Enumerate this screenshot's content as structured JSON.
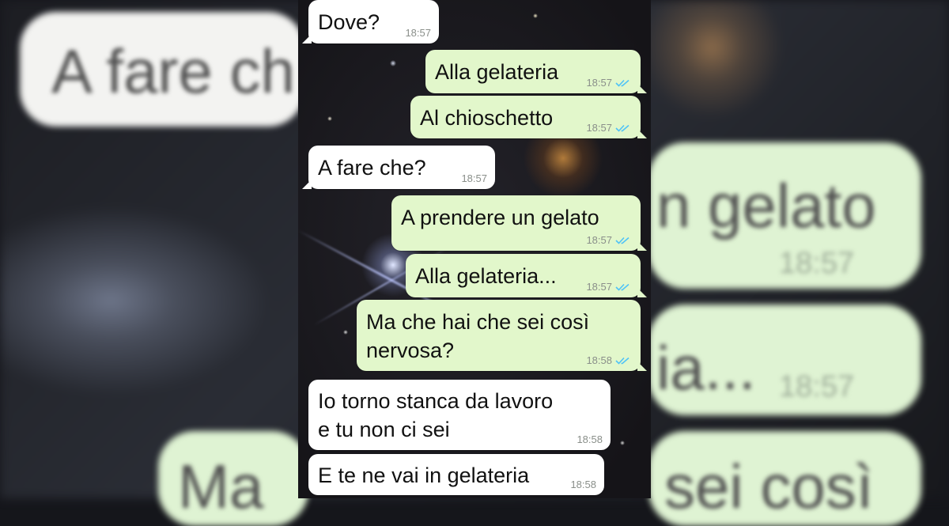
{
  "background": {
    "left_bubble_text": "A fare ch",
    "right_texts": [
      "n gelato",
      "ia...",
      "sei così"
    ],
    "right_times": [
      "18:57",
      "18:57"
    ],
    "left_bottom_text": "Ma"
  },
  "colors": {
    "incoming_bubble": "#ffffff",
    "outgoing_bubble": "#e2f7cb",
    "read_checks": "#4fc3f7",
    "timestamp": "#8a8f8a"
  },
  "messages": [
    {
      "direction": "in",
      "text": "Dove?",
      "time": "18:57"
    },
    {
      "direction": "out",
      "text": "Alla gelateria",
      "time": "18:57",
      "status_icon": "double-check-icon"
    },
    {
      "direction": "out",
      "text": "Al chioschetto",
      "time": "18:57",
      "status_icon": "double-check-icon"
    },
    {
      "direction": "in",
      "text": "A fare che?",
      "time": "18:57"
    },
    {
      "direction": "out",
      "text": "A prendere un gelato",
      "time": "18:57",
      "status_icon": "double-check-icon"
    },
    {
      "direction": "out",
      "text": "Alla gelateria...",
      "time": "18:57",
      "status_icon": "double-check-icon"
    },
    {
      "direction": "out",
      "text": "Ma che hai che sei così\nnervosa?",
      "time": "18:58",
      "status_icon": "double-check-icon"
    },
    {
      "direction": "in",
      "text": "Io torno stanca da lavoro\ne tu non ci sei",
      "time": "18:58"
    },
    {
      "direction": "in",
      "text": "E te ne vai in gelateria",
      "time": "18:58"
    }
  ]
}
